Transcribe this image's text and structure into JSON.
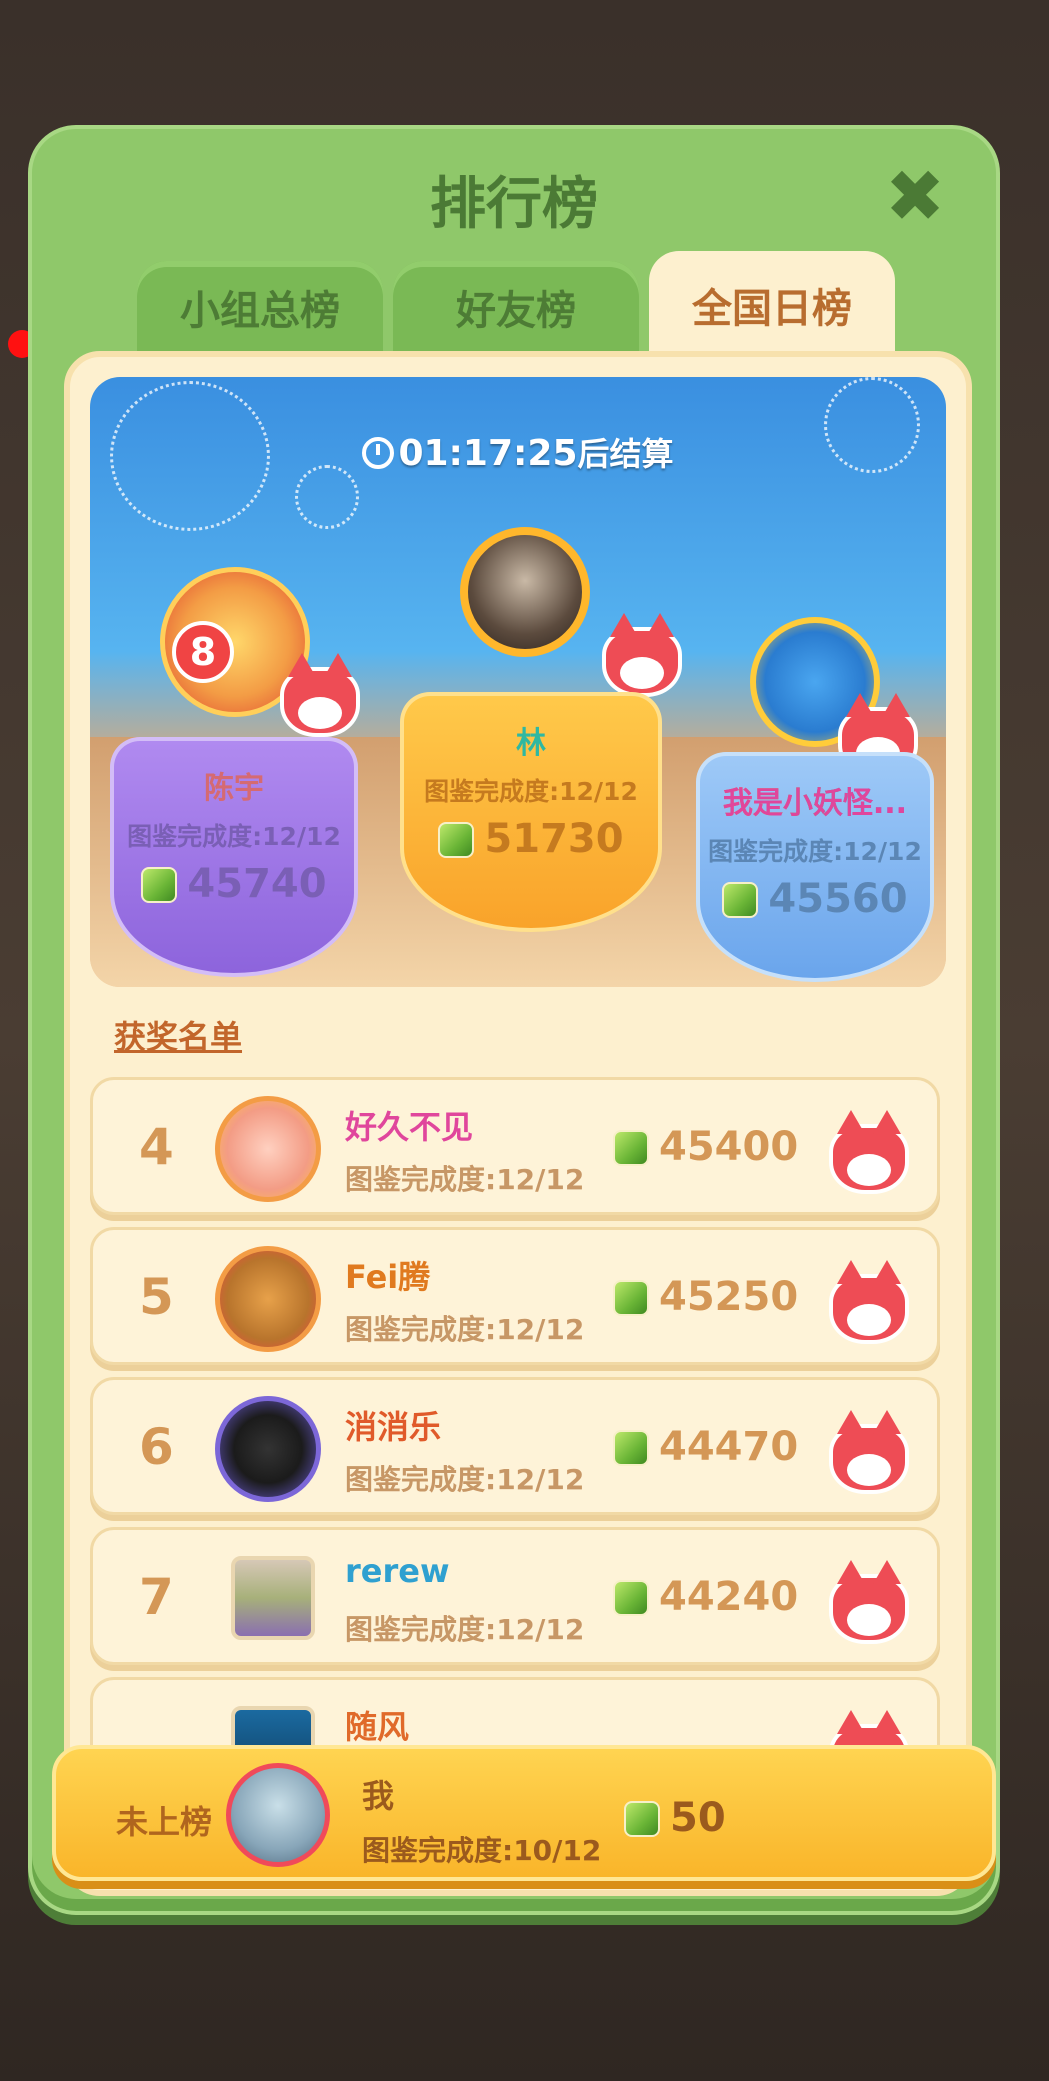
{
  "title": "排行榜",
  "tabs": [
    {
      "label": "小组总榜",
      "active": false
    },
    {
      "label": "好友榜",
      "active": false
    },
    {
      "label": "全国日榜",
      "active": true
    }
  ],
  "countdown": {
    "time": "01:17:25",
    "suffix": "后结算"
  },
  "podium": {
    "first": {
      "name": "林",
      "progress": "图鉴完成度:12/12",
      "score": "51730",
      "frame_label": "1000"
    },
    "second": {
      "name": "陈宇",
      "progress": "图鉴完成度:12/12",
      "score": "45740",
      "badge": "8",
      "frame_label": "福"
    },
    "third": {
      "name": "我是小妖怪...",
      "progress": "图鉴完成度:12/12",
      "score": "45560",
      "frame_label": "开心 小神仙"
    }
  },
  "awards_label": "获奖名单",
  "rows": [
    {
      "rank": "4",
      "name": "好久不见",
      "progress": "图鉴完成度:12/12",
      "score": "45400",
      "frame_label": "1000",
      "name_color": "#e0469c"
    },
    {
      "rank": "5",
      "name": "Fei腾",
      "progress": "图鉴完成度:12/12",
      "score": "45250",
      "frame_label": "福",
      "name_color": "#e07a1f"
    },
    {
      "rank": "6",
      "name": "消消乐",
      "progress": "图鉴完成度:12/12",
      "score": "44470",
      "frame_label": "前程似锦",
      "name_color": "#e05a2a"
    },
    {
      "rank": "7",
      "name": "rerew",
      "progress": "图鉴完成度:12/12",
      "score": "44240",
      "frame_label": "",
      "name_color": "#2fa0d0"
    },
    {
      "rank": "",
      "name": "随风",
      "progress": "",
      "score": "",
      "frame_label": "",
      "name_color": "#e06a2a"
    }
  ],
  "me": {
    "status": "未上榜",
    "name": "我",
    "progress": "图鉴完成度:10/12",
    "score": "50",
    "frame_label": "福"
  },
  "colors": {
    "panel_green": "#8fc86a",
    "accent_orange": "#d49756",
    "gold_bar": "#f9b52a",
    "fox_red": "#ee4c55"
  },
  "icons": [
    "close-icon",
    "clock-icon",
    "gem-icon",
    "fox-icon"
  ]
}
